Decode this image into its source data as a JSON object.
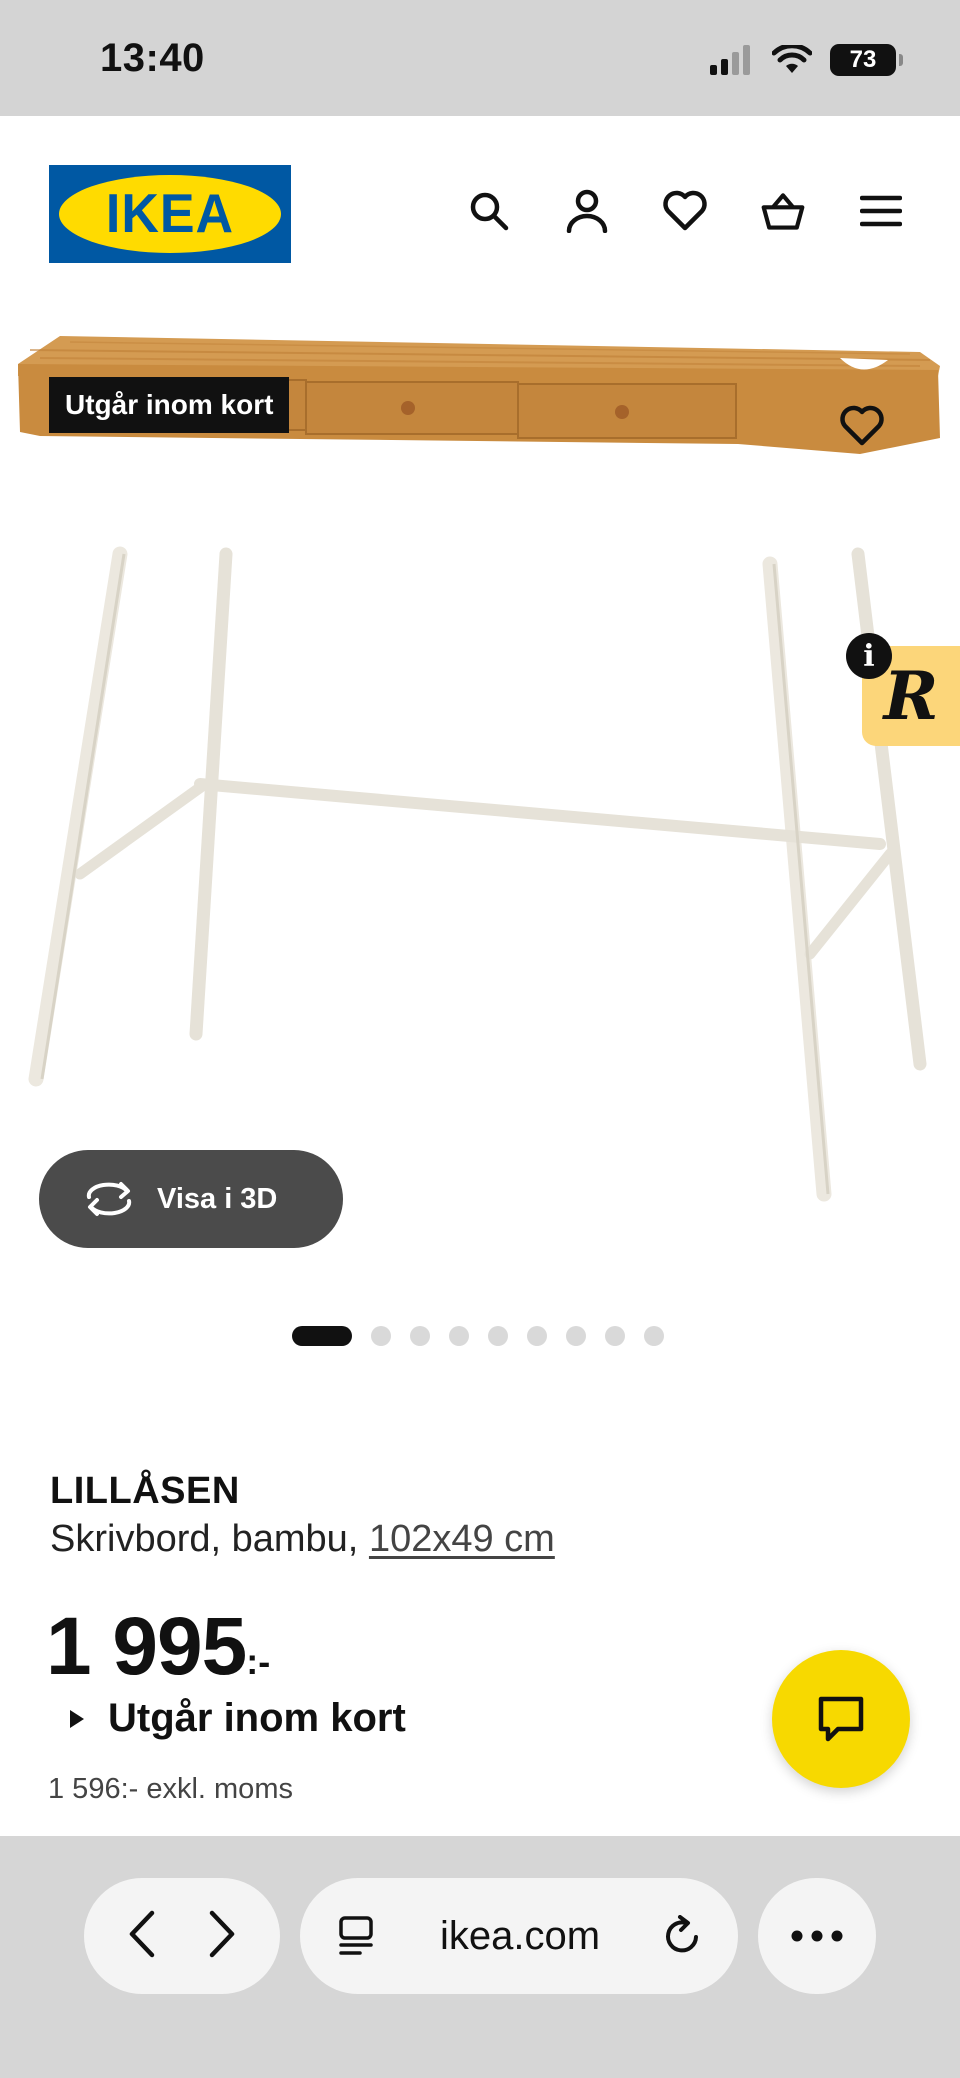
{
  "status_bar": {
    "time": "13:40",
    "battery": "73"
  },
  "header": {
    "logo_text": "IKEA",
    "icons": [
      "search-icon",
      "account-icon",
      "heart-icon",
      "cart-icon",
      "menu-icon"
    ]
  },
  "product": {
    "badge": "Utgår inom kort",
    "view_3d_label": "Visa i 3D",
    "widget_letter": "R",
    "widget_info": "i",
    "gallery": {
      "count": 9,
      "active_index": 0
    },
    "name": "LILLÅSEN",
    "description": "Skrivbord, bambu,",
    "dimensions": "102x49 cm",
    "price": "1 995",
    "price_suffix": ":-",
    "availability": "Utgår inom kort",
    "excl_vat": "1 596:- exkl. moms"
  },
  "browser": {
    "url": "ikea.com"
  },
  "colors": {
    "ikea_blue": "#0058a3",
    "ikea_yellow": "#ffdb00",
    "chat_yellow": "#f7d900",
    "wood": "#c98b3f",
    "frame": "#ece8df"
  }
}
